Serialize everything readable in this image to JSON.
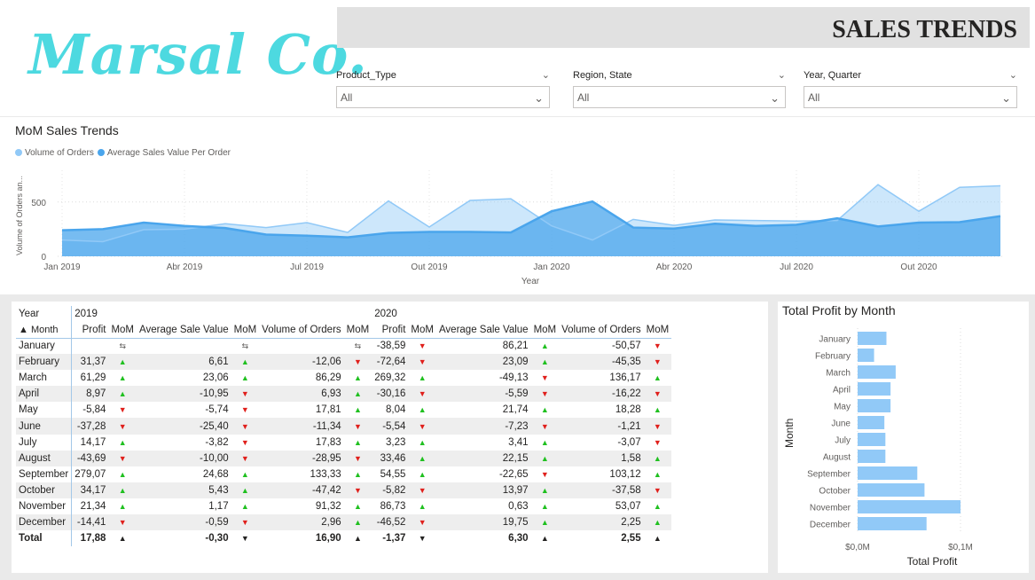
{
  "header": {
    "logo_text": "Marsal Co.",
    "title": "SALES TRENDS"
  },
  "slicers": [
    {
      "label": "Product_Type",
      "value": "All"
    },
    {
      "label": "Region, State",
      "value": "All"
    },
    {
      "label": "Year, Quarter",
      "value": "All"
    }
  ],
  "colors": {
    "volume": "#91c9f7",
    "avg_value": "#4aa5ec",
    "bar": "#91c9f7",
    "up": "#20c020",
    "down": "#e0201c",
    "title_bar": "#e1e1e1",
    "logo": "#4dd9e0"
  },
  "chart_data": [
    {
      "type": "area",
      "title": "MoM Sales Trends",
      "xlabel": "Year",
      "ylabel": "Volume of Orders an...",
      "ylim": [
        0,
        800
      ],
      "yticks": [
        0,
        500
      ],
      "xticks": [
        "Jan 2019",
        "Abr 2019",
        "Jul 2019",
        "Out 2019",
        "Jan 2020",
        "Abr 2020",
        "Jul 2020",
        "Out 2020"
      ],
      "x": [
        "Jan 2019",
        "Fev 2019",
        "Mar 2019",
        "Abr 2019",
        "Mai 2019",
        "Jun 2019",
        "Jul 2019",
        "Ago 2019",
        "Set 2019",
        "Out 2019",
        "Nov 2019",
        "Dez 2019",
        "Jan 2020",
        "Fev 2020",
        "Mar 2020",
        "Abr 2020",
        "Mai 2020",
        "Jun 2020",
        "Jul 2020",
        "Ago 2020",
        "Set 2020",
        "Out 2020",
        "Nov 2020",
        "Dez 2020"
      ],
      "legend_position": "top-left",
      "series": [
        {
          "name": "Volume of Orders",
          "values": [
            150,
            135,
            245,
            250,
            300,
            265,
            310,
            220,
            510,
            270,
            515,
            530,
            280,
            150,
            340,
            285,
            335,
            330,
            325,
            330,
            660,
            415,
            635,
            650
          ]
        },
        {
          "name": "Average Sales Value Per Order",
          "values": [
            240,
            250,
            310,
            280,
            260,
            200,
            190,
            175,
            215,
            225,
            225,
            220,
            415,
            505,
            265,
            255,
            300,
            280,
            290,
            350,
            275,
            310,
            315,
            370
          ]
        }
      ]
    },
    {
      "type": "bar",
      "title": "Total Profit by Month",
      "xlabel": "Total Profit",
      "ylabel": "Month",
      "xticks": [
        "$0,0M",
        "$0,1M"
      ],
      "xlim": [
        0,
        0.1
      ],
      "categories": [
        "January",
        "February",
        "March",
        "April",
        "May",
        "June",
        "July",
        "August",
        "September",
        "October",
        "November",
        "December"
      ],
      "values": [
        0.028,
        0.016,
        0.037,
        0.032,
        0.032,
        0.026,
        0.027,
        0.027,
        0.058,
        0.065,
        0.1,
        0.067
      ]
    }
  ],
  "table": {
    "header_year_label": "Year",
    "header_month_label": "Month",
    "years": [
      "2019",
      "2020"
    ],
    "columns": [
      "Profit",
      "MoM",
      "Average Sale Value",
      "MoM",
      "Volume of Orders",
      "MoM",
      "Profit",
      "MoM",
      "Average Sale Value",
      "MoM",
      "Volume of Orders",
      "MoM"
    ],
    "rows": [
      {
        "month": "January",
        "cells": [
          "",
          "swap",
          "",
          "swap",
          "",
          "swap",
          "-38,59",
          "down",
          "86,21",
          "up",
          "-50,57",
          "down"
        ]
      },
      {
        "month": "February",
        "cells": [
          "31,37",
          "up",
          "6,61",
          "up",
          "-12,06",
          "down",
          "-72,64",
          "down",
          "23,09",
          "up",
          "-45,35",
          "down"
        ]
      },
      {
        "month": "March",
        "cells": [
          "61,29",
          "up",
          "23,06",
          "up",
          "86,29",
          "up",
          "269,32",
          "up",
          "-49,13",
          "down",
          "136,17",
          "up"
        ]
      },
      {
        "month": "April",
        "cells": [
          "8,97",
          "up",
          "-10,95",
          "down",
          "6,93",
          "up",
          "-30,16",
          "down",
          "-5,59",
          "down",
          "-16,22",
          "down"
        ]
      },
      {
        "month": "May",
        "cells": [
          "-5,84",
          "down",
          "-5,74",
          "down",
          "17,81",
          "up",
          "8,04",
          "up",
          "21,74",
          "up",
          "18,28",
          "up"
        ]
      },
      {
        "month": "June",
        "cells": [
          "-37,28",
          "down",
          "-25,40",
          "down",
          "-11,34",
          "down",
          "-5,54",
          "down",
          "-7,23",
          "down",
          "-1,21",
          "down"
        ]
      },
      {
        "month": "July",
        "cells": [
          "14,17",
          "up",
          "-3,82",
          "down",
          "17,83",
          "up",
          "3,23",
          "up",
          "3,41",
          "up",
          "-3,07",
          "down"
        ]
      },
      {
        "month": "August",
        "cells": [
          "-43,69",
          "down",
          "-10,00",
          "down",
          "-28,95",
          "down",
          "33,46",
          "up",
          "22,15",
          "up",
          "1,58",
          "up"
        ]
      },
      {
        "month": "September",
        "cells": [
          "279,07",
          "up",
          "24,68",
          "up",
          "133,33",
          "up",
          "54,55",
          "up",
          "-22,65",
          "down",
          "103,12",
          "up"
        ]
      },
      {
        "month": "October",
        "cells": [
          "34,17",
          "up",
          "5,43",
          "up",
          "-47,42",
          "down",
          "-5,82",
          "down",
          "13,97",
          "up",
          "-37,58",
          "down"
        ]
      },
      {
        "month": "November",
        "cells": [
          "21,34",
          "up",
          "1,17",
          "up",
          "91,32",
          "up",
          "86,73",
          "up",
          "0,63",
          "up",
          "53,07",
          "up"
        ]
      },
      {
        "month": "December",
        "cells": [
          "-14,41",
          "down",
          "-0,59",
          "down",
          "2,96",
          "up",
          "-46,52",
          "down",
          "19,75",
          "up",
          "2,25",
          "up"
        ]
      }
    ],
    "total": {
      "month": "Total",
      "cells": [
        "17,88",
        "blk-up",
        "-0,30",
        "blk-down",
        "16,90",
        "blk-up",
        "-1,37",
        "blk-down",
        "6,30",
        "blk-up",
        "2,55",
        "blk-up"
      ]
    }
  }
}
